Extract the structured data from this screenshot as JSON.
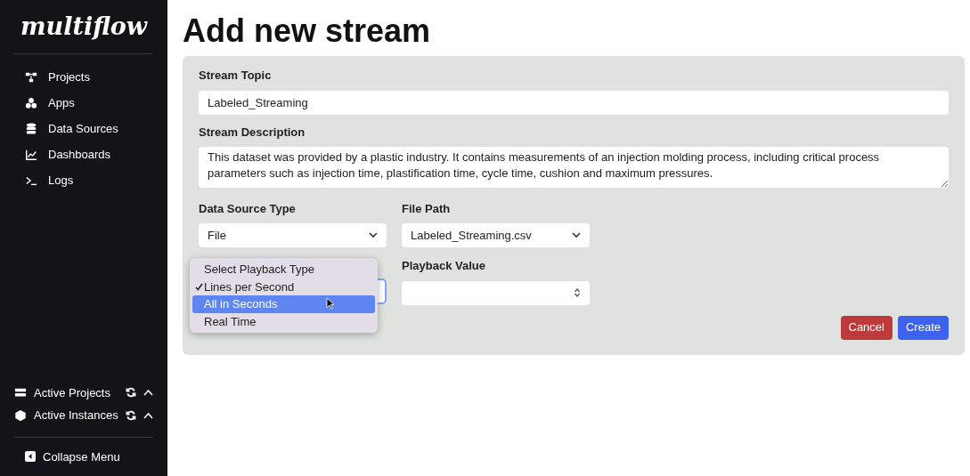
{
  "sidebar": {
    "logo": "multiflow",
    "items": [
      {
        "label": "Projects"
      },
      {
        "label": "Apps"
      },
      {
        "label": "Data Sources"
      },
      {
        "label": "Dashboards"
      },
      {
        "label": "Logs"
      }
    ],
    "sections": [
      {
        "label": "Active Projects",
        "expanded": true
      },
      {
        "label": "Active Instances",
        "expanded": true
      }
    ],
    "collapse": "Collapse Menu"
  },
  "page": {
    "title": "Add new stream"
  },
  "form": {
    "stream_topic": {
      "label": "Stream Topic",
      "value": "Labeled_Streaming"
    },
    "stream_description": {
      "label": "Stream Description",
      "value": "This dataset was provided by a plastic industry. It contains measurements of an injection molding process, including critical process parameters such as injection time, plastification time, cycle time, cushion and maximum pressures."
    },
    "data_source_type": {
      "label": "Data Source Type",
      "value": "File"
    },
    "file_path": {
      "label": "File Path",
      "value": "Labeled_Streaming.csv"
    },
    "playback_type_menu": [
      {
        "label": "Select Playback Type",
        "checked": false,
        "selected": false
      },
      {
        "label": "Lines per Second",
        "checked": true,
        "selected": false
      },
      {
        "label": "All in Seconds",
        "checked": false,
        "selected": true
      },
      {
        "label": "Real Time",
        "checked": false,
        "selected": false
      }
    ],
    "playback_value": {
      "label": "Playback Value"
    },
    "buttons": [
      {
        "label": "Cancel",
        "kind": "danger"
      },
      {
        "label": "Create",
        "kind": "primary"
      }
    ]
  }
}
